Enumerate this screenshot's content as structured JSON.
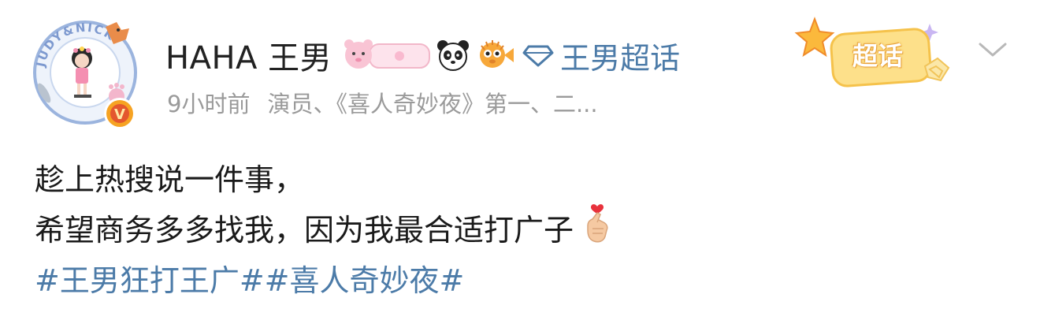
{
  "post": {
    "username": "HAHA 王男",
    "topic_link": "王男超话",
    "time": "9小时前",
    "source": "演员、《喜人奇妙夜》第一、二...",
    "chaohua_sticker": "超话",
    "avatar_ring_text": "JUDY&NICK",
    "verified_badge": "V",
    "body_lines": [
      "趁上热搜说一件事，",
      "希望商务多多找我，因为我最合适打广子"
    ],
    "hashtags": "#王男狂打王广##喜人奇妙夜#",
    "icons": {
      "badges": [
        "pink-bear-badge-icon",
        "panda-icon",
        "blowfish-icon",
        "diamond-icon"
      ],
      "more": "chevron-down-icon",
      "emoji": "finger-heart-icon"
    },
    "colors": {
      "link": "#4c7ba8",
      "meta": "#9a9a9a",
      "text": "#1a1a1a"
    }
  }
}
